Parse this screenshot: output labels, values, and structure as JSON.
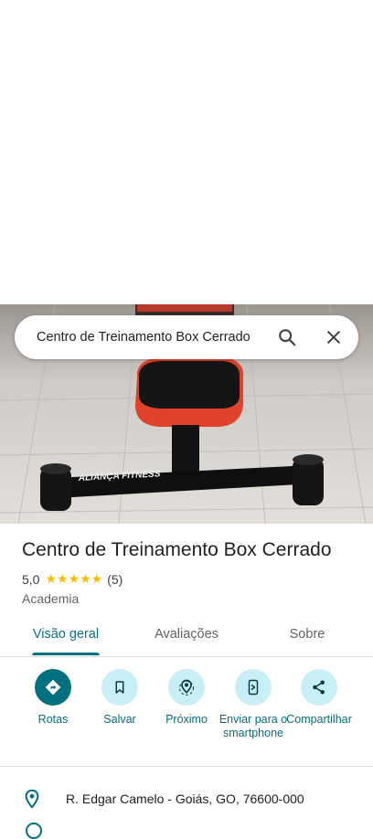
{
  "search": {
    "query": "Centro de Treinamento Box Cerrado",
    "search_icon": "search-icon",
    "close_icon": "close-icon"
  },
  "photo": {
    "brand_text": "ALIANÇA FITNESS"
  },
  "place": {
    "title": "Centro de Treinamento Box Cerrado",
    "rating": "5,0",
    "stars": "★★★★★",
    "review_count": "(5)",
    "category": "Academia"
  },
  "tabs": [
    {
      "label": "Visão geral",
      "active": true
    },
    {
      "label": "Avaliações",
      "active": false
    },
    {
      "label": "Sobre",
      "active": false
    }
  ],
  "actions": [
    {
      "label": "Rotas",
      "icon": "directions-icon"
    },
    {
      "label": "Salvar",
      "icon": "bookmark-icon"
    },
    {
      "label": "Próximo",
      "icon": "nearby-icon"
    },
    {
      "label": "Enviar para o smartphone",
      "icon": "send-to-phone-icon"
    },
    {
      "label": "Compartilhar",
      "icon": "share-icon"
    }
  ],
  "address": {
    "text": "R. Edgar Camelo - Goiás, GO, 76600-000",
    "icon": "location-pin-icon"
  },
  "colors": {
    "accent": "#00707e",
    "accent_light": "#c9eff6",
    "star": "#fbbc04"
  }
}
